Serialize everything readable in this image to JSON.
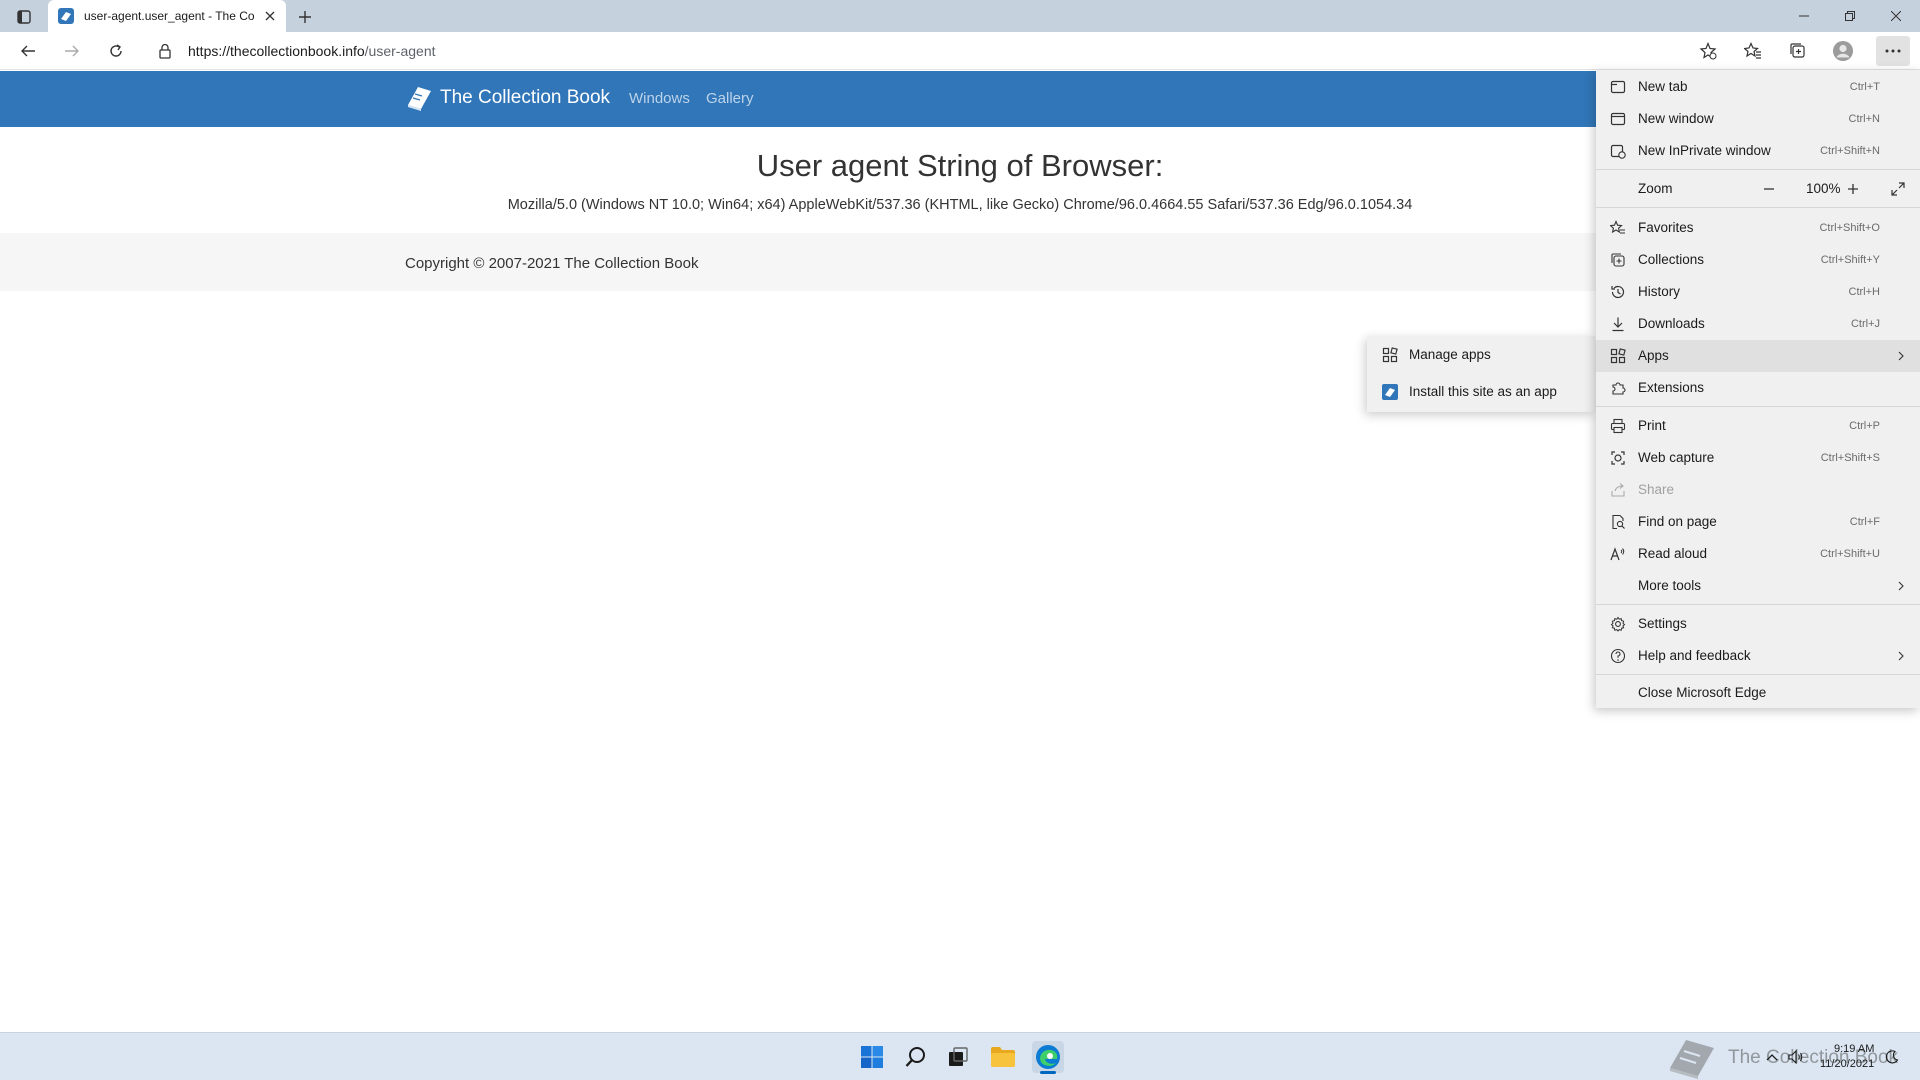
{
  "browser": {
    "tab_title": "user-agent.user_agent - The Coll",
    "url_host": "https://thecollectionbook.info",
    "url_path": "/user-agent"
  },
  "site": {
    "brand": "The Collection Book",
    "nav": [
      "Windows",
      "Gallery"
    ],
    "heading": "User agent String of Browser:",
    "ua_string": "Mozilla/5.0 (Windows NT 10.0; Win64; x64) AppleWebKit/537.36 (KHTML, like Gecko) Chrome/96.0.4664.55 Safari/537.36 Edg/96.0.1054.34",
    "copyright": "Copyright © 2007-2021 The Collection Book"
  },
  "menu": {
    "new_tab": {
      "label": "New tab",
      "shortcut": "Ctrl+T"
    },
    "new_window": {
      "label": "New window",
      "shortcut": "Ctrl+N"
    },
    "new_inprivate": {
      "label": "New InPrivate window",
      "shortcut": "Ctrl+Shift+N"
    },
    "zoom": {
      "label": "Zoom",
      "value": "100%"
    },
    "favorites": {
      "label": "Favorites",
      "shortcut": "Ctrl+Shift+O"
    },
    "collections": {
      "label": "Collections",
      "shortcut": "Ctrl+Shift+Y"
    },
    "history": {
      "label": "History",
      "shortcut": "Ctrl+H"
    },
    "downloads": {
      "label": "Downloads",
      "shortcut": "Ctrl+J"
    },
    "apps": {
      "label": "Apps"
    },
    "extensions": {
      "label": "Extensions"
    },
    "print": {
      "label": "Print",
      "shortcut": "Ctrl+P"
    },
    "web_capture": {
      "label": "Web capture",
      "shortcut": "Ctrl+Shift+S"
    },
    "share": {
      "label": "Share"
    },
    "find_on_page": {
      "label": "Find on page",
      "shortcut": "Ctrl+F"
    },
    "read_aloud": {
      "label": "Read aloud",
      "shortcut": "Ctrl+Shift+U"
    },
    "more_tools": {
      "label": "More tools"
    },
    "settings": {
      "label": "Settings"
    },
    "help": {
      "label": "Help and feedback"
    },
    "close_edge": {
      "label": "Close Microsoft Edge"
    }
  },
  "submenu": {
    "manage_apps": "Manage apps",
    "install_site": "Install this site as an app"
  },
  "taskbar": {
    "watermark": "The Collection Book",
    "time": "9:19 AM",
    "date": "11/20/2021"
  },
  "colors": {
    "site_header": "#3176b8",
    "tabbar": "#c6d1de",
    "menu_bg": "#f0f0f0",
    "taskbar": "#dbe6f2"
  }
}
